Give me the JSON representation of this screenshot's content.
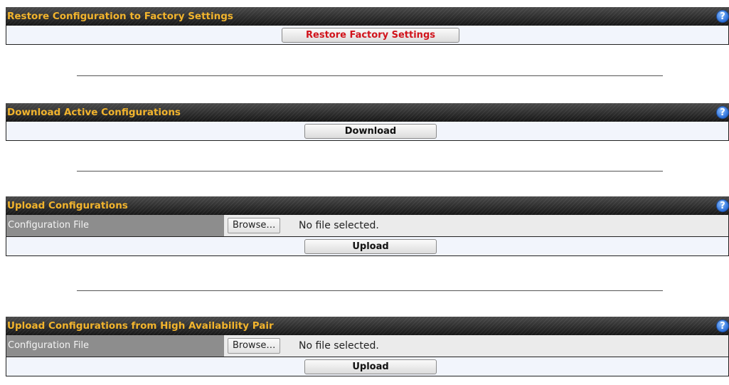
{
  "sections": [
    {
      "title": "Restore Configuration to Factory Settings",
      "button_label": "Restore Factory Settings"
    },
    {
      "title": "Download Active Configurations",
      "button_label": "Download"
    },
    {
      "title": "Upload Configurations",
      "file_label": "Configuration File",
      "browse_label": "Browse…",
      "file_status": "No file selected.",
      "button_label": "Upload"
    },
    {
      "title": "Upload Configurations from High Availability Pair",
      "file_label": "Configuration File",
      "browse_label": "Browse…",
      "file_status": "No file selected.",
      "button_label": "Upload"
    }
  ],
  "help_symbol": "?",
  "icons": {
    "help": "help-icon"
  },
  "colors": {
    "header_text": "#f2b42d",
    "restore_button_text": "#d1131b",
    "row_background": "#f2f5fc",
    "label_background": "#8d8d8d"
  }
}
